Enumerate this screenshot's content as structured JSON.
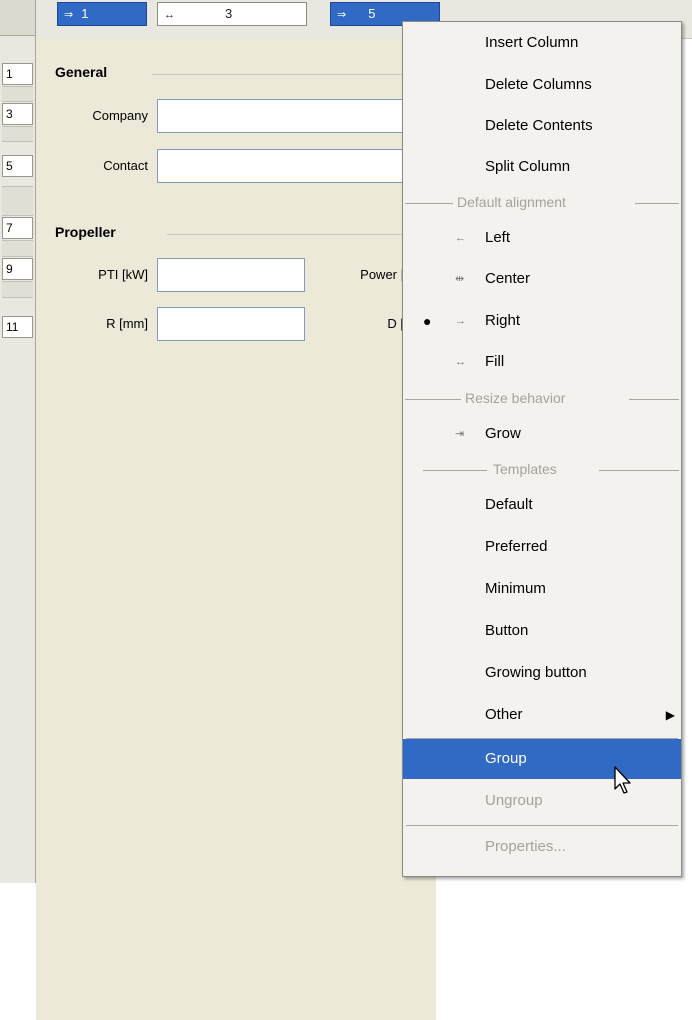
{
  "columns": [
    {
      "icon": "⇒",
      "label": "1",
      "state": "selected"
    },
    {
      "icon": "↔",
      "label": "3",
      "state": "plain"
    },
    {
      "icon": "⇒",
      "label": "5",
      "state": "selected"
    }
  ],
  "rows": [
    "1",
    "3",
    "5",
    "7",
    "9",
    "11"
  ],
  "form": {
    "general_title": "General",
    "company_label": "Company",
    "contact_label": "Contact",
    "propeller_title": "Propeller",
    "pti_label": "PTI [kW]",
    "power_label": "Power |",
    "r_label": "R [mm]",
    "d_label": "D ["
  },
  "menu": {
    "insert_column": "Insert Column",
    "delete_columns": "Delete Columns",
    "delete_contents": "Delete Contents",
    "split_column": "Split Column",
    "default_alignment_header": "Default alignment",
    "align_left_icon": "←",
    "align_left": "Left",
    "align_center_icon": "⇹",
    "align_center": "Center",
    "align_right_icon": "→",
    "align_right": "Right",
    "align_fill_icon": "↔",
    "align_fill": "Fill",
    "selected_marker": "●",
    "resize_header": "Resize behavior",
    "grow_icon": "⇥",
    "grow": "Grow",
    "templates_header": "Templates",
    "tpl_default": "Default",
    "tpl_preferred": "Preferred",
    "tpl_minimum": "Minimum",
    "tpl_button": "Button",
    "tpl_growing_button": "Growing button",
    "other": "Other",
    "other_arrow": "▶",
    "group": "Group",
    "ungroup": "Ungroup",
    "properties": "Properties..."
  },
  "colors": {
    "selection": "#316ac5",
    "panel": "#ece9d8",
    "menu_bg": "#f3f2ee",
    "disabled_text": "#a3a39c"
  }
}
